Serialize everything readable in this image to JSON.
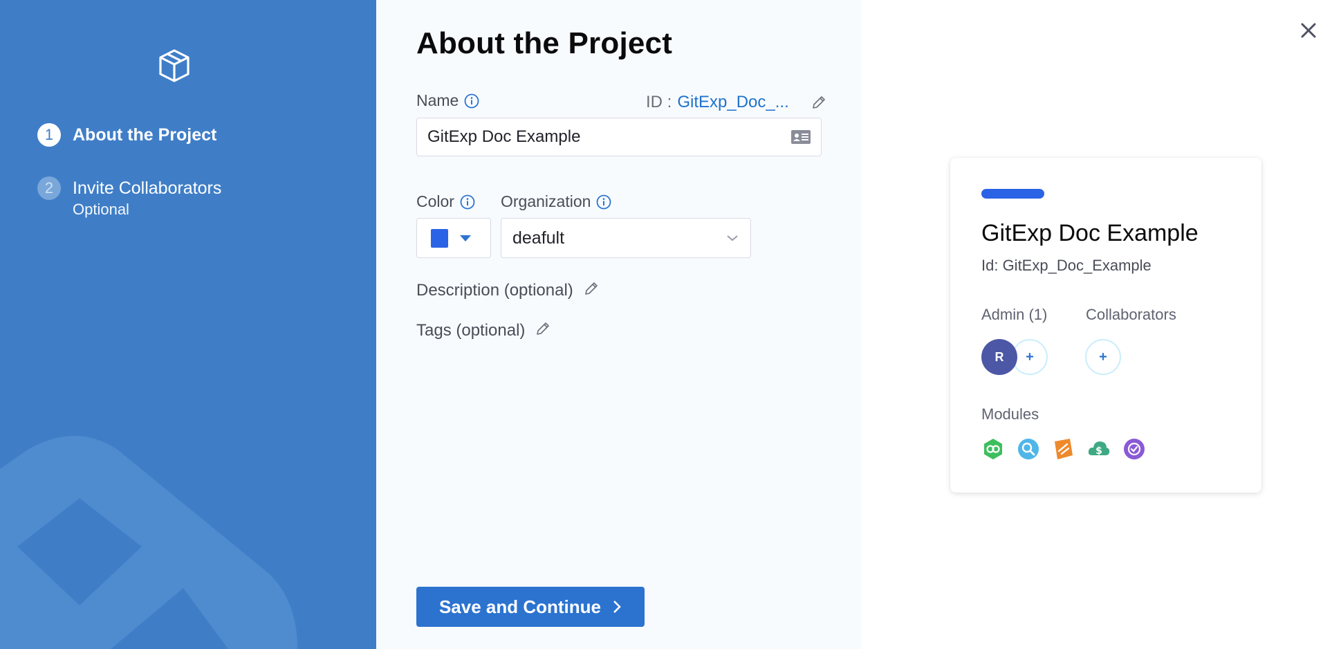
{
  "wizard": {
    "logo_icon": "cube-icon",
    "steps": [
      {
        "number": "1",
        "label": "About the Project",
        "sublabel": "",
        "state": "active"
      },
      {
        "number": "2",
        "label": "Invite Collaborators",
        "sublabel": "Optional",
        "state": "inactive"
      }
    ]
  },
  "form": {
    "title": "About the Project",
    "name_label": "Name",
    "id_prefix": "ID :",
    "id_value": "GitExp_Doc_...",
    "name_value": "GitExp Doc Example",
    "color_label": "Color",
    "color_value": "#2b63e6",
    "organization_label": "Organization",
    "organization_value": "deafult",
    "description_label": "Description (optional)",
    "tags_label": "Tags (optional)",
    "save_label": "Save and Continue"
  },
  "preview": {
    "strip_color": "#2b63e6",
    "title": "GitExp Doc Example",
    "id_text": "Id: GitExp_Doc_Example",
    "admin_label": "Admin (1)",
    "admin_initial": "R",
    "add_symbol": "+",
    "collaborators_label": "Collaborators",
    "modules_label": "Modules",
    "modules": [
      "cd-module-icon",
      "ci-module-icon",
      "cv-module-icon",
      "ccm-module-icon",
      "cf-module-icon"
    ]
  },
  "colors": {
    "sidebar_bg": "#3f7ec7",
    "primary": "#2c73cf",
    "link": "#1f73cc"
  }
}
